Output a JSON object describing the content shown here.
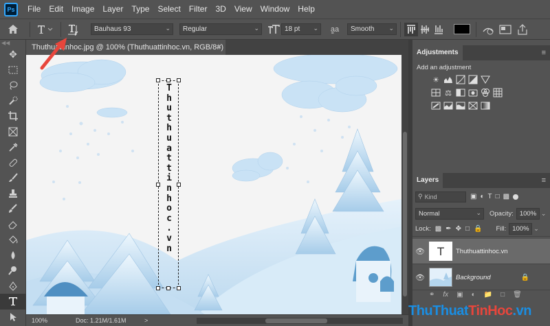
{
  "app": {
    "logo_text": "Ps"
  },
  "menu": [
    "File",
    "Edit",
    "Image",
    "Layer",
    "Type",
    "Select",
    "Filter",
    "3D",
    "View",
    "Window",
    "Help"
  ],
  "options": {
    "font_family": "Bauhaus 93",
    "font_style": "Regular",
    "font_size": "18 pt",
    "antialias_icon_text": "a̳a",
    "antialias": "Smooth",
    "text_color": "#000000"
  },
  "document": {
    "tab_title": "Thuthuattinhoc.jpg @ 100% (Thuthuattinhoc.vn, RGB/8#) *",
    "close": "×",
    "vertical_text": [
      "T",
      "h",
      "u",
      "t",
      "h",
      "u",
      "a",
      "t",
      "t",
      "i",
      "n",
      "h",
      "o",
      "c",
      ".",
      "v",
      "n"
    ]
  },
  "status": {
    "zoom": "100%",
    "doc": "Doc: 1.21M/1.61M",
    "nav": ">"
  },
  "adjustments": {
    "title": "Adjustments",
    "subtitle": "Add an adjustment"
  },
  "layers": {
    "title": "Layers",
    "search_placeholder": "Kind",
    "blend_mode": "Normal",
    "opacity_label": "Opacity:",
    "opacity": "100%",
    "lock_label": "Lock:",
    "fill_label": "Fill:",
    "fill": "100%",
    "items": [
      {
        "name": "Thuthuattinhoc.vn",
        "type": "text",
        "thumb_text": "T"
      },
      {
        "name": "Background",
        "type": "image"
      }
    ]
  },
  "watermark": {
    "part1": "ThuThuat",
    "part2": "TinHoc",
    "part3": ".vn"
  },
  "colors": {
    "accent": "#31a8ff",
    "panel": "#535353",
    "dark": "#424242",
    "arrow": "#e8463c",
    "snow": "#cfe7f7",
    "snow_dark": "#7fb3d8"
  }
}
